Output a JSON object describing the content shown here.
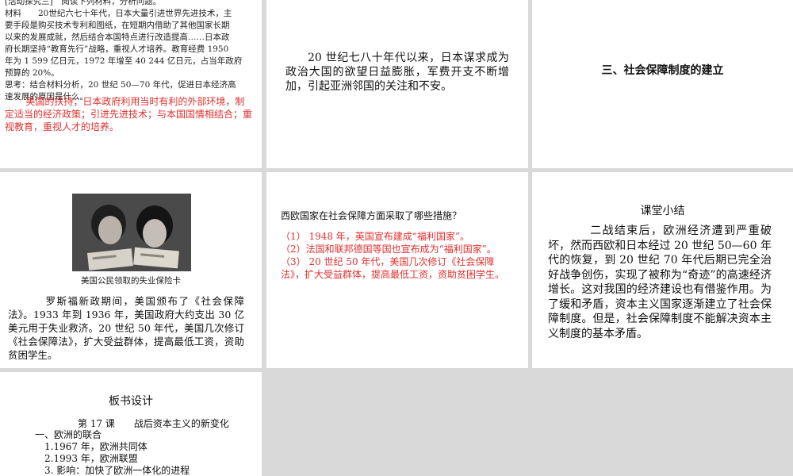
{
  "slide1": {
    "heading": "[活动探究三]　阅读下列材料，分析问题。",
    "material_lines": [
      "材料　　20世纪六七十年代，日本大量引进世界先进技术，主",
      "要手段是购买技术专利和图纸，在短期内借助了其他国家长期",
      "以来的发展成就，然后结合本国特点进行改造提高……日本政",
      "府长期坚持“教育先行”战略，重视人才培养。教育经费 1950",
      "年为 1 599 亿日元，1972 年增至 40 244 亿日元，占当年政府",
      "预算的 20%。",
      "思考：结合材料分析，20 世纪 50—70 年代，促进日本经济高",
      "速发展的原因是什么。"
    ],
    "answer": "美国的扶持；日本政府利用当时有利的外部环境，制定适当的经济政策；引进先进技术；与本国国情相结合；重视教育，重视人才的培养。"
  },
  "slide2": {
    "paragraph": "20 世纪七八十年代以来，日本谋求成为政治大国的欲望日益膨胀，军费开支不断增加，引起亚洲邻国的关注和不安。"
  },
  "slide3": {
    "title": "三、社会保障制度的建立"
  },
  "slide4": {
    "caption": "美国公民领取的失业保险卡",
    "paragraph": "罗斯福新政期间，美国颁布了《社会保障法》。1933 年到 1936 年，美国政府大约支出 30 亿美元用于失业救济。20 世纪 50 年代，美国几次修订《社会保障法》，扩大受益群体，提高最低工资，资助贫困学生。"
  },
  "slide5": {
    "question": "西欧国家在社会保障方面采取了哪些措施？",
    "answers": [
      "（1） 1948 年，英国宣布建成“福利国家”。",
      "（2）法国和联邦德国等国也宣布成为“福利国家”。",
      "（3） 20 世纪 50 年代，美国几次修订《社会保障法》，扩大受益群体，提高最低工资，资助贫困学生。"
    ]
  },
  "slide6": {
    "title": "课堂小结",
    "paragraph": "二战结束后，欧洲经济遭到严重破坏，然而西欧和日本经过 20 世纪 50—60 年代的恢复，到 20 世纪 70 年代后期已完全治好战争创伤，实现了被称为“奇迹”的高速经济增长。这对我国的经济建设也有借鉴作用。为了缓和矛盾，资本主义国家逐渐建立了社会保障制度。但是，社会保障制度不能解决资本主义制度的基本矛盾。"
  },
  "slide7": {
    "title": "板书设计",
    "lesson": "第 17 课　　战后资本主义的新变化",
    "outline": [
      "一、欧洲的联合",
      "1.1967 年，欧洲共同体",
      "2.1993 年，欧洲联盟",
      "3. 影响：加快了欧洲一体化的进程"
    ]
  }
}
